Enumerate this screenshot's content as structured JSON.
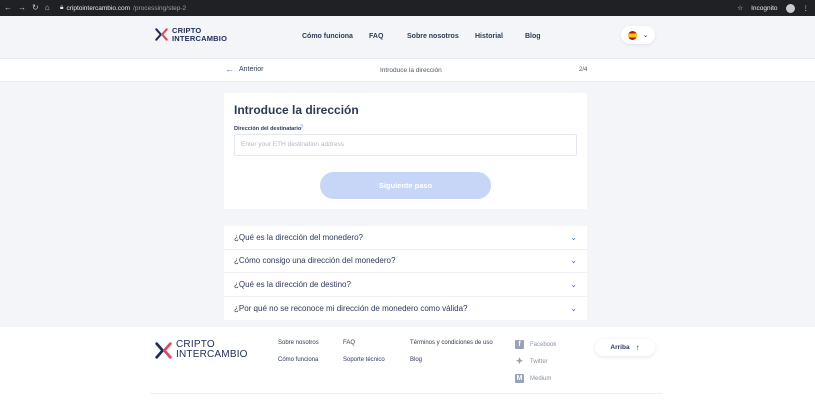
{
  "browser": {
    "url_host": "criptointercambio.com",
    "url_path": "/processing/step-2",
    "profile_label": "Incognito"
  },
  "brand": {
    "line1": "CRIPTO",
    "line2": "INTERCAMBIO",
    "colors": {
      "blue": "#1f2d54",
      "red": "#e6465b"
    }
  },
  "nav": {
    "items": [
      "Cómo funciona",
      "FAQ",
      "Sobre nosotros",
      "Historial",
      "Blog"
    ],
    "language_icon": "spain-flag-icon"
  },
  "stepbar": {
    "back_label": "Anterior",
    "title": "Introduce la dirección",
    "step": "2/4"
  },
  "form": {
    "heading": "Introduce la dirección",
    "field_label": "Dirección del destinatario",
    "help_symbol": "?",
    "input_placeholder": "Enter your ETH destination address",
    "submit_label": "Siguiente paso",
    "accent_color": "#3b6fe0"
  },
  "faq": [
    "¿Qué es la dirección del monedero?",
    "¿Cómo consigo una dirección del monedero?",
    "¿Qué es la dirección de destino?",
    "¿Por qué no se reconoce mi dirección de monedero como válida?"
  ],
  "footer": {
    "col1": [
      "Sobre nosotros",
      "Cómo funciona"
    ],
    "col2": [
      "FAQ",
      "Soporte técnico"
    ],
    "col3": [
      "Términos y condiciones de uso",
      "Blog"
    ],
    "social": [
      {
        "label": "Facebook",
        "icon": "facebook-icon"
      },
      {
        "label": "Twitter",
        "icon": "twitter-icon"
      },
      {
        "label": "Medium",
        "icon": "medium-icon"
      }
    ],
    "top_label": "Arriba"
  }
}
